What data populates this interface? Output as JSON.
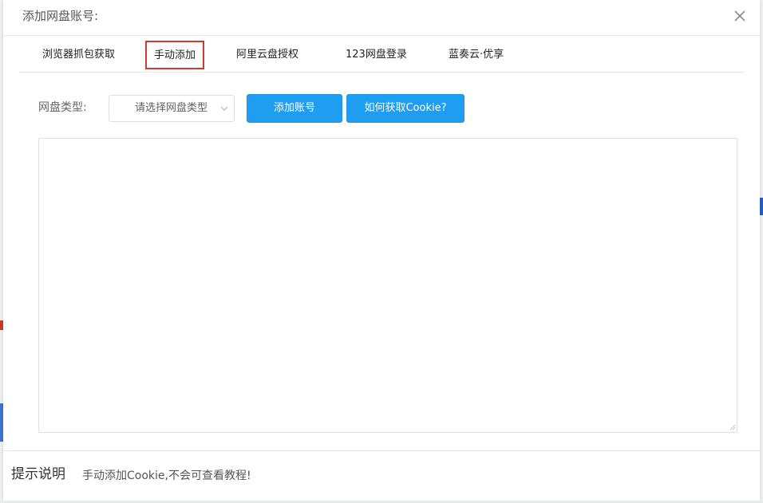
{
  "dialog": {
    "title": "添加网盘账号:"
  },
  "tabs": [
    {
      "label": "浏览器抓包获取",
      "active": false
    },
    {
      "label": "手动添加",
      "active": true
    },
    {
      "label": "阿里云盘授权",
      "active": false
    },
    {
      "label": "123网盘登录",
      "active": false
    },
    {
      "label": "蓝奏云·优享",
      "active": false
    }
  ],
  "form": {
    "disk_type_label": "网盘类型:",
    "disk_type_placeholder": "请选择网盘类型",
    "add_account_label": "添加账号",
    "how_to_cookie_label": "如何获取Cookie?",
    "cookie_textarea_value": ""
  },
  "footer": {
    "title": "提示说明",
    "text": "手动添加Cookie,不会可查看教程!"
  },
  "colors": {
    "primary": "#1f9df0",
    "active_tab_border": "#cf3b32"
  }
}
